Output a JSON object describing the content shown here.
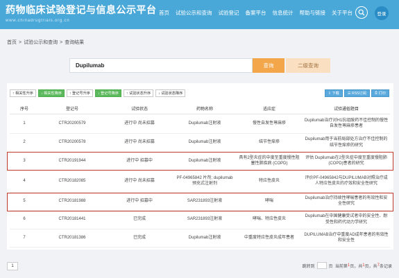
{
  "header": {
    "title": "药物临床试验登记与信息公示平台",
    "subtitle": "www.chinadrugtrials.org.cn",
    "nav": [
      "首页",
      "试验公示和查询",
      "试验登记",
      "备案平台",
      "信息统计",
      "帮助与链接",
      "关于平台"
    ],
    "login": "登录"
  },
  "breadcrumb": [
    "首页",
    "试验公示和查询",
    "查询结果"
  ],
  "search": {
    "value": "Dupilumab",
    "query_label": "查询",
    "advanced_label": "二级查询"
  },
  "toolbar": {
    "left": [
      "相关性升序",
      "相关性降序",
      "登记号升序",
      "登记号降序",
      "试验状态升序",
      "试验状态降序"
    ],
    "right": [
      "下载",
      "RSS订阅",
      "打印"
    ]
  },
  "table": {
    "headers": [
      "序号",
      "登记号",
      "试验状态",
      "药物名称",
      "适应症",
      "试验通俗题目"
    ],
    "rows": [
      [
        "1",
        "CTR20200579",
        "进行中 尚未招募",
        "Dupilumab注射液",
        "慢性自发性荨麻疹",
        "Dupilumab治疗对H1抗组胺药不佳控制的慢性自发性荨麻疹患者"
      ],
      [
        "2",
        "CTR20200578",
        "进行中 尚未招募",
        "Dupilumab注射液",
        "结节性痒疹",
        "Dupilumab用于当前局部处方治疗不佳控制的结节性痒疹的研究"
      ],
      [
        "3",
        "CTR20191944",
        "进行中 招募中",
        "Dupilumab注射液",
        "具有2型炎症的中度至重度慢性阻塞性肺疾病 (COPD)",
        "评估 Dupilumab在2型炎症中度至重度慢阻肺(COPD)患者的研究"
      ],
      [
        "4",
        "CTR20182085",
        "进行中 尚未招募",
        "PF-04965842 片剂; dupilumab 预充式注射剂",
        "特应性皮炎",
        "评价PF-04965842与DUPILUMAB对照治疗成人特应性皮炎的疗效和安全性研究"
      ],
      [
        "5",
        "CTR20181988",
        "进行中 招募中",
        "SAR231893注射液",
        "哮喘",
        "Dupilumab治疗持续性哮喘患者的有效性和安全性研究"
      ],
      [
        "6",
        "CTR20181441",
        "已完成",
        "SAR231893注射液",
        "哮喘、特应性皮炎",
        "Dupilumab在中国健康受试者中的安全性、耐受性和药代动力学研究"
      ],
      [
        "7",
        "CTR20181386",
        "已完成",
        "Dupilumab注射液",
        "中重度特应性皮炎成年患者",
        "DUPILUMAB治疗中重度AD成年患者的有效性和安全性"
      ]
    ]
  },
  "pagination": {
    "page_button": "1",
    "goto_label": "跳转到",
    "page_unit": "页",
    "current_prefix": "当前第",
    "current_page": "1",
    "total_mid": "页，共",
    "total_pages": "1",
    "records_mid": "页，共",
    "total_records": "7",
    "records_suffix": "条记录"
  },
  "colors": {
    "header": "#4aa8d8",
    "query": "#f3a64a",
    "advanced": "#fae0c0",
    "highlight": "#c0392b",
    "green": "#5cb85c"
  }
}
